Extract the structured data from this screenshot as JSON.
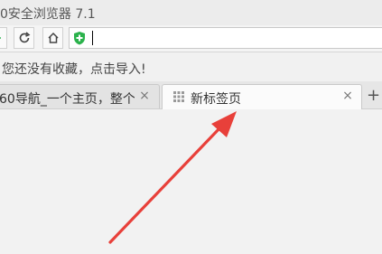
{
  "window": {
    "title": "0安全浏览器 7.1"
  },
  "toolbar": {
    "icons": [
      "back-icon",
      "refresh-icon",
      "home-icon",
      "security-shield-icon"
    ],
    "address_value": ""
  },
  "bookmarks_bar": {
    "message": "您还没有收藏，点击导入!"
  },
  "tabs": [
    {
      "label": "60导航_一个主页，整个",
      "close": "×",
      "active": false
    },
    {
      "label": "新标签页",
      "close": "×",
      "active": true
    }
  ],
  "new_tab": "+",
  "colors": {
    "shield_green": "#2bb24c",
    "arrow_red": "#e8403a"
  }
}
